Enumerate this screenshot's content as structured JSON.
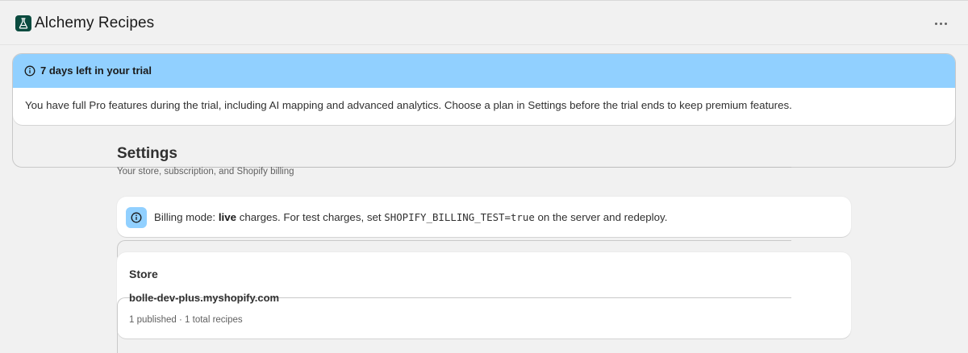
{
  "app": {
    "title": "Alchemy Recipes",
    "logo_icon": "flask-icon",
    "more_icon": "more-horizontal-icon"
  },
  "trial_banner": {
    "title": "7 days left in your trial",
    "message": "You have full Pro features during the trial, including AI mapping and advanced analytics. Choose a plan in Settings before the trial ends to keep premium features.",
    "icon": "info-icon",
    "accent_color": "#91d0ff"
  },
  "settings": {
    "title": "Settings",
    "subtitle": "Your store, subscription, and Shopify billing"
  },
  "billing_notice": {
    "icon": "info-icon",
    "prefix": "Billing mode: ",
    "mode": "live",
    "middle": " charges. For test charges, set ",
    "env_var": "SHOPIFY_BILLING_TEST=true",
    "suffix": " on the server and redeploy."
  },
  "store": {
    "title": "Store",
    "domain": "bolle-dev-plus.myshopify.com",
    "stats": "1 published · 1 total recipes"
  }
}
